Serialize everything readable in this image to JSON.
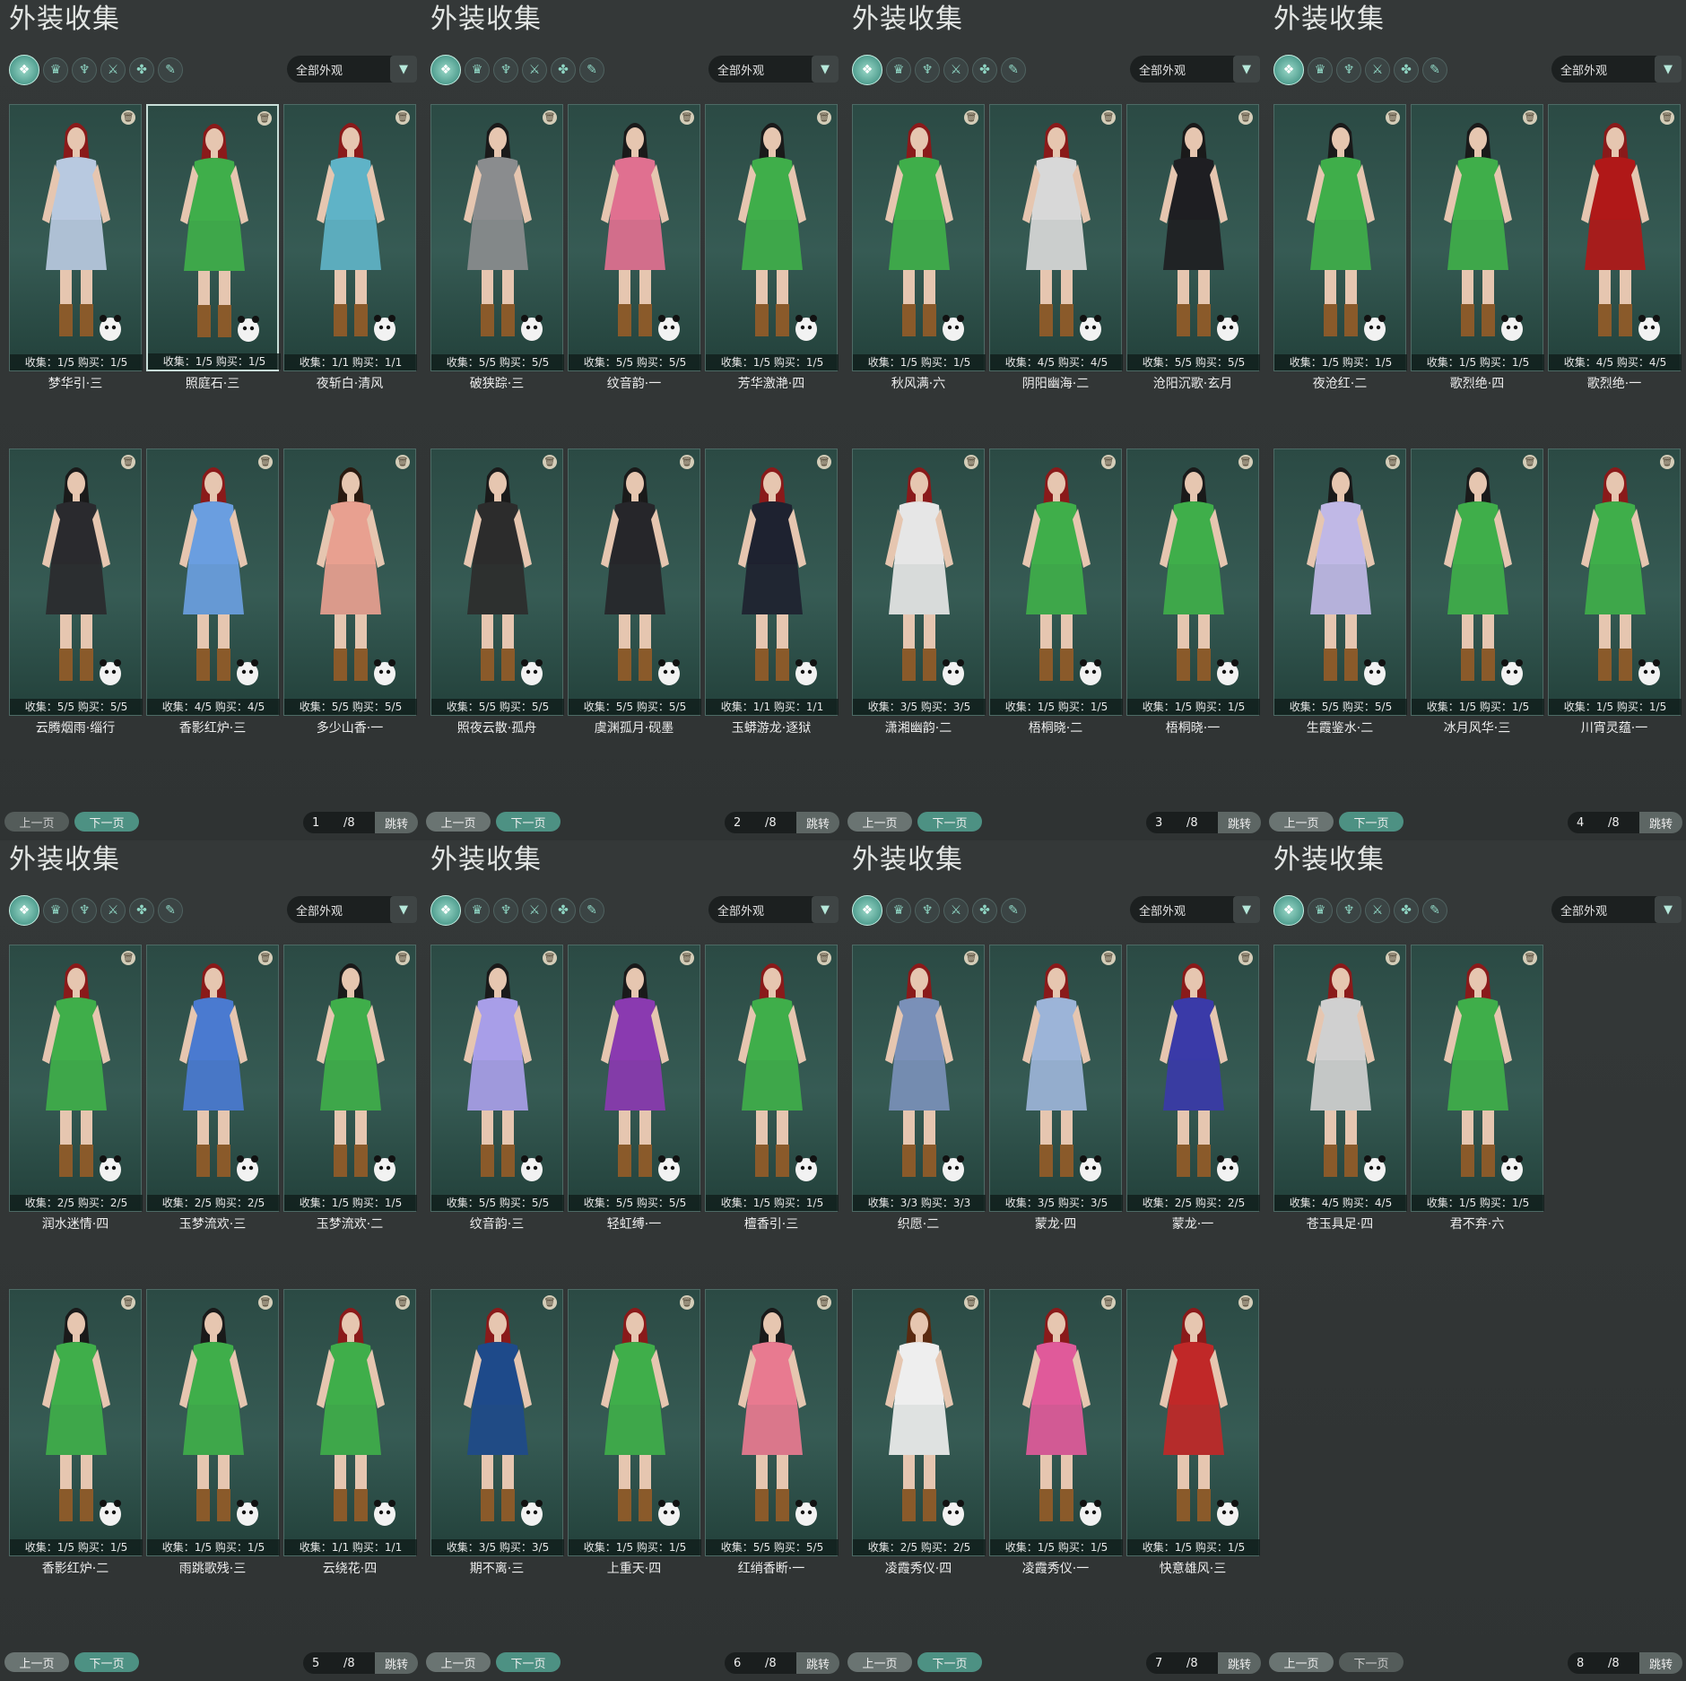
{
  "title": "外装收集",
  "filter_icons": [
    "all-outfit-icon",
    "head-icon",
    "top-icon",
    "weapon-icon",
    "mount-icon",
    "misc-icon"
  ],
  "dropdown_value": "全部外观",
  "pager": {
    "prev": "上一页",
    "next": "下一页",
    "jump": "跳转",
    "total": "/8"
  },
  "pages": [
    {
      "page": "1",
      "items": [
        {
          "name": "梦华引·三",
          "stat": "收集：1/5  购买：1/5",
          "outfit": "#b8c9e0",
          "hair": "#8a1a1a",
          "selected": false
        },
        {
          "name": "照庭石·三",
          "stat": "收集：1/5  购买：1/5",
          "outfit": "#3fae4a",
          "hair": "#8a1a1a",
          "selected": true
        },
        {
          "name": "夜斩白·清风",
          "stat": "收集：1/1  购买：1/1",
          "outfit": "#5fb3c7",
          "hair": "#8a1a1a",
          "selected": false
        },
        {
          "name": "云腾烟雨·缁行",
          "stat": "收集：5/5  购买：5/5",
          "outfit": "#2a2a2e",
          "hair": "#1a1a1a",
          "selected": false
        },
        {
          "name": "香影红炉·三",
          "stat": "收集：4/5  购买：4/5",
          "outfit": "#6a9ee0",
          "hair": "#8a1a1a",
          "selected": false
        },
        {
          "name": "多少山香·一",
          "stat": "收集：5/5  购买：5/5",
          "outfit": "#e8a090",
          "hair": "#2a1a10",
          "selected": false
        }
      ]
    },
    {
      "page": "2",
      "items": [
        {
          "name": "破狭踪·三",
          "stat": "收集：5/5  购买：5/5",
          "outfit": "#8a8c8e",
          "hair": "#1a1a1a",
          "selected": false
        },
        {
          "name": "纹音韵·一",
          "stat": "收集：5/5  购买：5/5",
          "outfit": "#e07090",
          "hair": "#1a1a1a",
          "selected": false
        },
        {
          "name": "芳华激滟·四",
          "stat": "收集：1/5  购买：1/5",
          "outfit": "#3fae4a",
          "hair": "#1a1a1a",
          "selected": false
        },
        {
          "name": "照夜云散·孤舟",
          "stat": "收集：5/5  购买：5/5",
          "outfit": "#2c2c2c",
          "hair": "#1a1a1a",
          "selected": false
        },
        {
          "name": "虞渊孤月·砚墨",
          "stat": "收集：5/5  购买：5/5",
          "outfit": "#26262a",
          "hair": "#1a1a1a",
          "selected": false
        },
        {
          "name": "玉蟒游龙·逐狱",
          "stat": "收集：1/1  购买：1/1",
          "outfit": "#1e2230",
          "hair": "#8a1a1a",
          "selected": false
        }
      ]
    },
    {
      "page": "3",
      "items": [
        {
          "name": "秋风满·六",
          "stat": "收集：1/5  购买：1/5",
          "outfit": "#3fae4a",
          "hair": "#8a1a1a",
          "selected": false
        },
        {
          "name": "阴阳幽海·二",
          "stat": "收集：4/5  购买：4/5",
          "outfit": "#d8d8d8",
          "hair": "#8a1a1a",
          "selected": false
        },
        {
          "name": "沧阳沉歌·玄月",
          "stat": "收集：5/5  购买：5/5",
          "outfit": "#1e1e22",
          "hair": "#1a1a1a",
          "selected": false
        },
        {
          "name": "潇湘幽韵·二",
          "stat": "收集：3/5  购买：3/5",
          "outfit": "#e6e6e6",
          "hair": "#8a1a1a",
          "selected": false
        },
        {
          "name": "梧桐晓·二",
          "stat": "收集：1/5  购买：1/5",
          "outfit": "#3fae4a",
          "hair": "#8a1a1a",
          "selected": false
        },
        {
          "name": "梧桐晓·一",
          "stat": "收集：1/5  购买：1/5",
          "outfit": "#3fae4a",
          "hair": "#1a1a1a",
          "selected": false
        }
      ]
    },
    {
      "page": "4",
      "items": [
        {
          "name": "夜沧红·二",
          "stat": "收集：1/5  购买：1/5",
          "outfit": "#3fae4a",
          "hair": "#1a1a1a",
          "selected": false
        },
        {
          "name": "歌烈绝·四",
          "stat": "收集：1/5  购买：1/5",
          "outfit": "#3fae4a",
          "hair": "#1a1a1a",
          "selected": false
        },
        {
          "name": "歌烈绝·一",
          "stat": "收集：4/5  购买：4/5",
          "outfit": "#b01818",
          "hair": "#8a1a1a",
          "selected": false
        },
        {
          "name": "生霞鉴水·二",
          "stat": "收集：5/5  购买：5/5",
          "outfit": "#c0b8e6",
          "hair": "#1a1a1a",
          "selected": false
        },
        {
          "name": "冰月风华·三",
          "stat": "收集：1/5  购买：1/5",
          "outfit": "#3fae4a",
          "hair": "#1a1a1a",
          "selected": false
        },
        {
          "name": "川宵灵蕴·一",
          "stat": "收集：1/5  购买：1/5",
          "outfit": "#3fae4a",
          "hair": "#8a1a1a",
          "selected": false
        }
      ]
    },
    {
      "page": "5",
      "items": [
        {
          "name": "润水迷情·四",
          "stat": "收集：2/5  购买：2/5",
          "outfit": "#3fae4a",
          "hair": "#8a1a1a",
          "selected": false
        },
        {
          "name": "玉梦流欢·三",
          "stat": "收集：2/5  购买：2/5",
          "outfit": "#4a7ad0",
          "hair": "#8a1a1a",
          "selected": false
        },
        {
          "name": "玉梦流欢·二",
          "stat": "收集：1/5  购买：1/5",
          "outfit": "#3fae4a",
          "hair": "#1a1a1a",
          "selected": false
        },
        {
          "name": "香影红炉·二",
          "stat": "收集：1/5  购买：1/5",
          "outfit": "#3fae4a",
          "hair": "#1a1a1a",
          "selected": false
        },
        {
          "name": "雨跳歌残·三",
          "stat": "收集：1/5  购买：1/5",
          "outfit": "#3fae4a",
          "hair": "#1a1a1a",
          "selected": false
        },
        {
          "name": "云绕花·四",
          "stat": "收集：1/1  购买：1/1",
          "outfit": "#3fae4a",
          "hair": "#8a1a1a",
          "selected": false
        }
      ]
    },
    {
      "page": "6",
      "items": [
        {
          "name": "纹音韵·三",
          "stat": "收集：5/5  购买：5/5",
          "outfit": "#a89ee8",
          "hair": "#1a1a1a",
          "selected": false
        },
        {
          "name": "轻虹缚·一",
          "stat": "收集：5/5  购买：5/5",
          "outfit": "#8a3ab0",
          "hair": "#1a1a1a",
          "selected": false
        },
        {
          "name": "檀香引·三",
          "stat": "收集：1/5  购买：1/5",
          "outfit": "#3fae4a",
          "hair": "#8a1a1a",
          "selected": false
        },
        {
          "name": "期不离·三",
          "stat": "收集：3/5  购买：3/5",
          "outfit": "#1e4a8a",
          "hair": "#8a1a1a",
          "selected": false
        },
        {
          "name": "上重天·四",
          "stat": "收集：1/5  购买：1/5",
          "outfit": "#3fae4a",
          "hair": "#8a1a1a",
          "selected": false
        },
        {
          "name": "红绡香断·一",
          "stat": "收集：5/5  购买：5/5",
          "outfit": "#e87a90",
          "hair": "#1a1a1a",
          "selected": false
        }
      ]
    },
    {
      "page": "7",
      "items": [
        {
          "name": "织愿·二",
          "stat": "收集：3/3  购买：3/3",
          "outfit": "#7a90b8",
          "hair": "#8a1a1a",
          "selected": false
        },
        {
          "name": "蒙龙·四",
          "stat": "收集：3/5  购买：3/5",
          "outfit": "#9cb4d8",
          "hair": "#8a1a1a",
          "selected": false
        },
        {
          "name": "蒙龙·一",
          "stat": "收集：2/5  购买：2/5",
          "outfit": "#3a3aa8",
          "hair": "#8a1a1a",
          "selected": false
        },
        {
          "name": "凌霞秀仪·四",
          "stat": "收集：2/5  购买：2/5",
          "outfit": "#eeeeee",
          "hair": "#5a2a10",
          "selected": false
        },
        {
          "name": "凌霞秀仪·一",
          "stat": "收集：1/5  购买：1/5",
          "outfit": "#e05a9a",
          "hair": "#8a1a1a",
          "selected": false
        },
        {
          "name": "快意雄风·三",
          "stat": "收集：1/5  购买：1/5",
          "outfit": "#c02828",
          "hair": "#8a1a1a",
          "selected": false
        }
      ]
    },
    {
      "page": "8",
      "items": [
        {
          "name": "苍玉具足·四",
          "stat": "收集：4/5  购买：4/5",
          "outfit": "#d0d0d0",
          "hair": "#8a1a1a",
          "selected": false
        },
        {
          "name": "君不弃·六",
          "stat": "收集：1/5  购买：1/5",
          "outfit": "#3fae4a",
          "hair": "#8a1a1a",
          "selected": false
        }
      ]
    }
  ]
}
